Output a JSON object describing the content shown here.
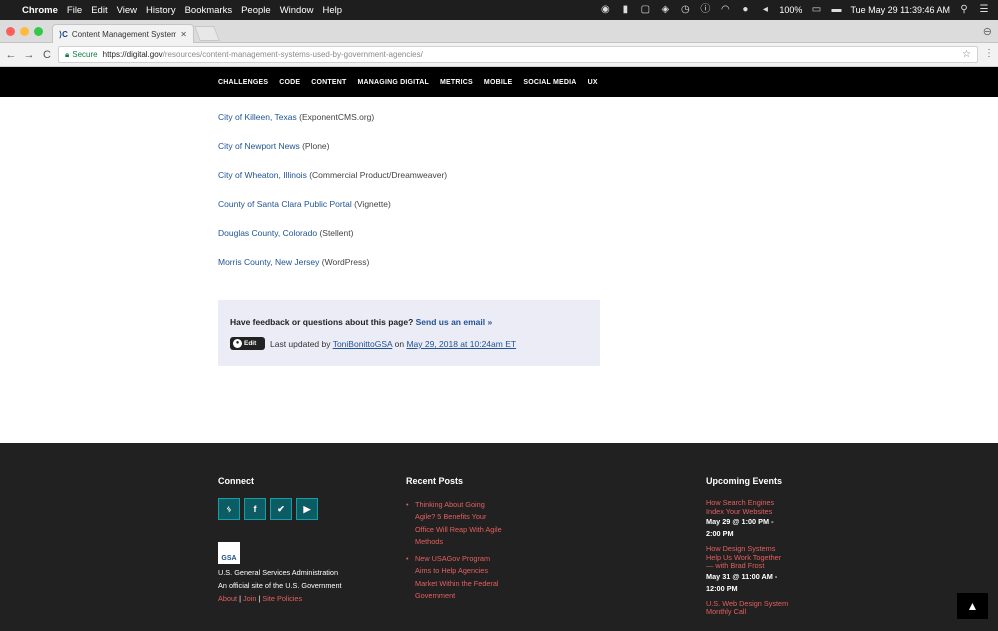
{
  "os_menubar": {
    "app": "Chrome",
    "menus": [
      "File",
      "Edit",
      "View",
      "History",
      "Bookmarks",
      "People",
      "Window",
      "Help"
    ],
    "battery": "100%",
    "datetime": "Tue May 29  11:39:46 AM"
  },
  "browser": {
    "tab_title": "Content Management Systems",
    "security_label": "Secure",
    "url_host": "https://digital.gov",
    "url_path": "/resources/content-management-systems-used-by-government-agencies/"
  },
  "site_nav": [
    "CHALLENGES",
    "CODE",
    "CONTENT",
    "MANAGING DIGITAL",
    "METRICS",
    "MOBILE",
    "SOCIAL MEDIA",
    "UX"
  ],
  "cms_list": [
    {
      "link": "City of Killeen, Texas",
      "detail": " (ExponentCMS.org)"
    },
    {
      "link": "City of Newport News",
      "detail": " (Plone)"
    },
    {
      "link": "City of Wheaton, Illinois",
      "detail": " (Commercial Product/Dreamweaver)"
    },
    {
      "link": "County of Santa Clara Public Portal",
      "detail": " (Vignette)"
    },
    {
      "link": "Douglas County, Colorado",
      "detail": " (Stellent)"
    },
    {
      "link": "Morris County, New Jersey",
      "detail": " (WordPress)"
    }
  ],
  "feedback": {
    "question": "Have feedback or questions about this page?",
    "email_link": "Send us an email »",
    "edit_label": "Edit",
    "updated_prefix": "Last updated by ",
    "author": "ToniBonittoGSA",
    "on": " on ",
    "date": "May 29, 2018 at 10:24am ET"
  },
  "footer": {
    "connect_heading": "Connect",
    "social_icons": [
      "rss-icon",
      "facebook-icon",
      "twitter-icon",
      "youtube-icon"
    ],
    "gsa_logo_text": "GSA",
    "gsa_name": "U.S. General Services Administration",
    "gsa_official": "An official site of the U.S. Government",
    "links": [
      "About",
      "Join",
      "Site Policies"
    ],
    "link_separator": " | ",
    "posts_heading": "Recent Posts",
    "posts": [
      "Thinking About Going Agile? 5 Benefits Your Office Will Reap With Agile Methods",
      "New USAGov Program Aims to Help Agencies Market Within the Federal Government"
    ],
    "events_heading": "Upcoming Events",
    "events": [
      {
        "title": "How Search Engines Index Your Websites",
        "time": "May 29 @ 1:00 PM - 2:00 PM"
      },
      {
        "title": "How Design Systems Help Us Work Together — with Brad Frost",
        "time": "May 31 @ 11:00 AM - 12:00 PM"
      },
      {
        "title": "U.S. Web Design System Monthly Call",
        "time": ""
      }
    ]
  },
  "colors": {
    "link": "#205493",
    "footer_bg": "#212121",
    "footer_link": "#e55f5f",
    "feedback_bg": "#ececf7",
    "social_teal": "#0d5c63"
  }
}
